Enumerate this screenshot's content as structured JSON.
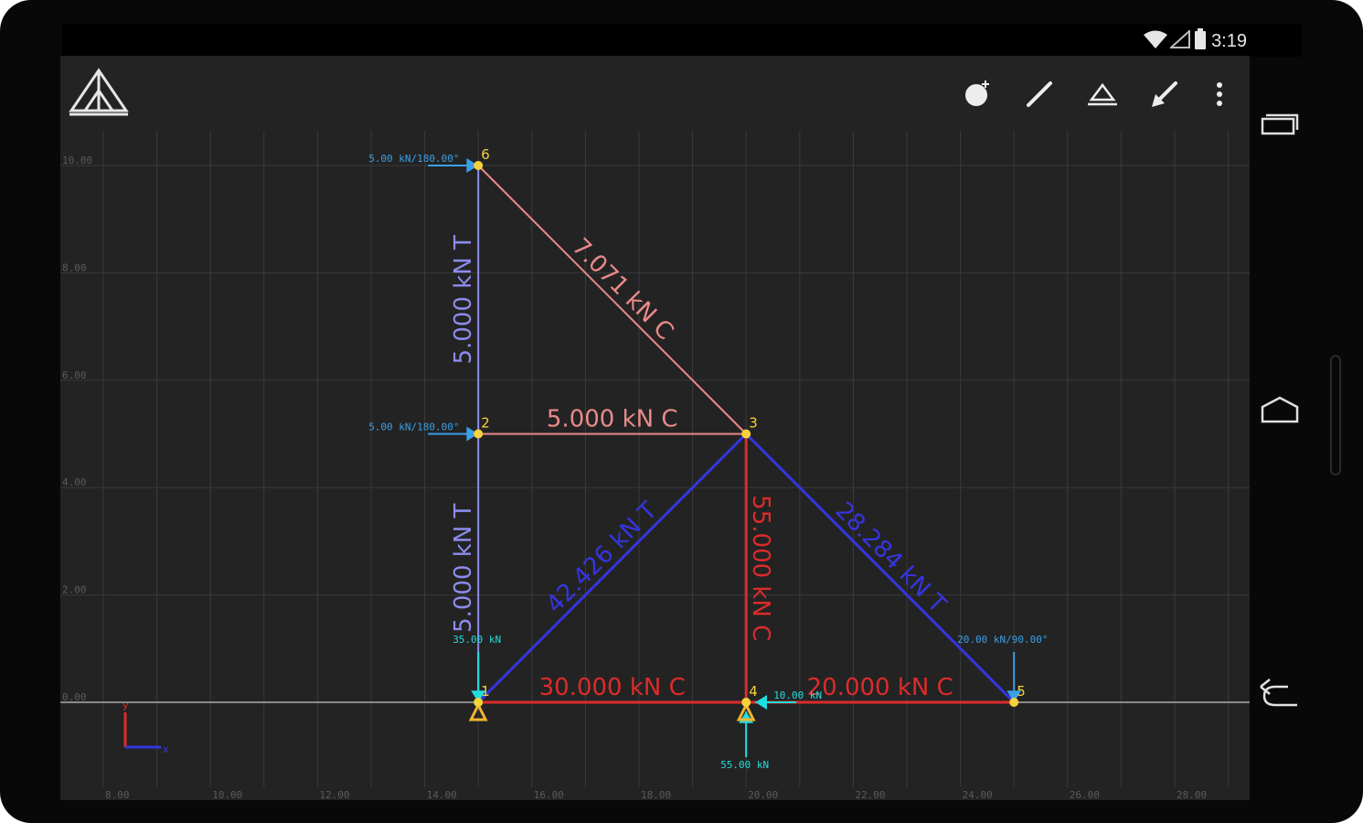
{
  "status_bar": {
    "time": "3:19"
  },
  "colors": {
    "background": "#232323",
    "grid": "#3a3a3a",
    "axis_line": "#8a8a8a",
    "tension": "#3535e0",
    "compression": "#dd2b2b",
    "zero_tension": "#8c8cee",
    "zero_compression": "#e98a8a",
    "load": "#3aa0e8",
    "reaction": "#22dddd",
    "node": "#f5d23a",
    "support": "#f3b52e"
  },
  "axes": {
    "x_ticks": [
      "8.00",
      "10.00",
      "12.00",
      "14.00",
      "16.00",
      "18.00",
      "20.00",
      "22.00",
      "24.00",
      "26.00",
      "28.00"
    ],
    "y_ticks": [
      "0.00",
      "2.00",
      "4.00",
      "6.00",
      "8.00",
      "10.00"
    ]
  },
  "nodes": [
    {
      "id": "1",
      "x": 15,
      "y": 0
    },
    {
      "id": "2",
      "x": 15,
      "y": 5
    },
    {
      "id": "3",
      "x": 20,
      "y": 5
    },
    {
      "id": "4",
      "x": 20,
      "y": 0
    },
    {
      "id": "5",
      "x": 25,
      "y": 0
    },
    {
      "id": "6",
      "x": 15,
      "y": 10
    }
  ],
  "members": [
    {
      "from": "1",
      "to": "2",
      "label": "5.000 kN T",
      "style": "zero_tension"
    },
    {
      "from": "2",
      "to": "6",
      "label": "5.000 kN T",
      "style": "zero_tension"
    },
    {
      "from": "2",
      "to": "3",
      "label": "5.000 kN C",
      "style": "zero_compression"
    },
    {
      "from": "6",
      "to": "3",
      "label": "7.071 kN C",
      "style": "zero_compression"
    },
    {
      "from": "1",
      "to": "3",
      "label": "42.426 kN T",
      "style": "tension"
    },
    {
      "from": "3",
      "to": "5",
      "label": "28.284 kN T",
      "style": "tension"
    },
    {
      "from": "3",
      "to": "4",
      "label": "55.000 kN C",
      "style": "compression"
    },
    {
      "from": "1",
      "to": "4",
      "label": "30.000 kN C",
      "style": "compression"
    },
    {
      "from": "4",
      "to": "5",
      "label": "20.000 kN C",
      "style": "compression"
    }
  ],
  "loads": [
    {
      "node": "6",
      "label": "5.00 kN/180.00°",
      "dir": "right"
    },
    {
      "node": "2",
      "label": "5.00 kN/180.00°",
      "dir": "right"
    },
    {
      "node": "5",
      "label": "20.00 kN/90.00°",
      "dir": "down"
    }
  ],
  "reactions": [
    {
      "node": "1",
      "label": "35.00 kN",
      "dir": "down"
    },
    {
      "node": "4",
      "label": "55.00 kN",
      "dir": "up"
    },
    {
      "node": "4",
      "label": "10.00 kN",
      "dir": "left"
    }
  ],
  "supports": [
    {
      "node": "1",
      "type": "pin"
    },
    {
      "node": "4",
      "type": "pin"
    }
  ],
  "axis_indicator": {
    "x_label": "x",
    "y_label": "y"
  },
  "icons": {
    "app_logo": "truss-logo-icon",
    "add_node": "add-node-icon",
    "add_member": "add-member-icon",
    "add_support": "add-support-icon",
    "add_load": "add-load-icon",
    "overflow": "overflow-menu-icon",
    "recents": "recents-icon",
    "home": "home-icon",
    "back": "back-icon"
  }
}
